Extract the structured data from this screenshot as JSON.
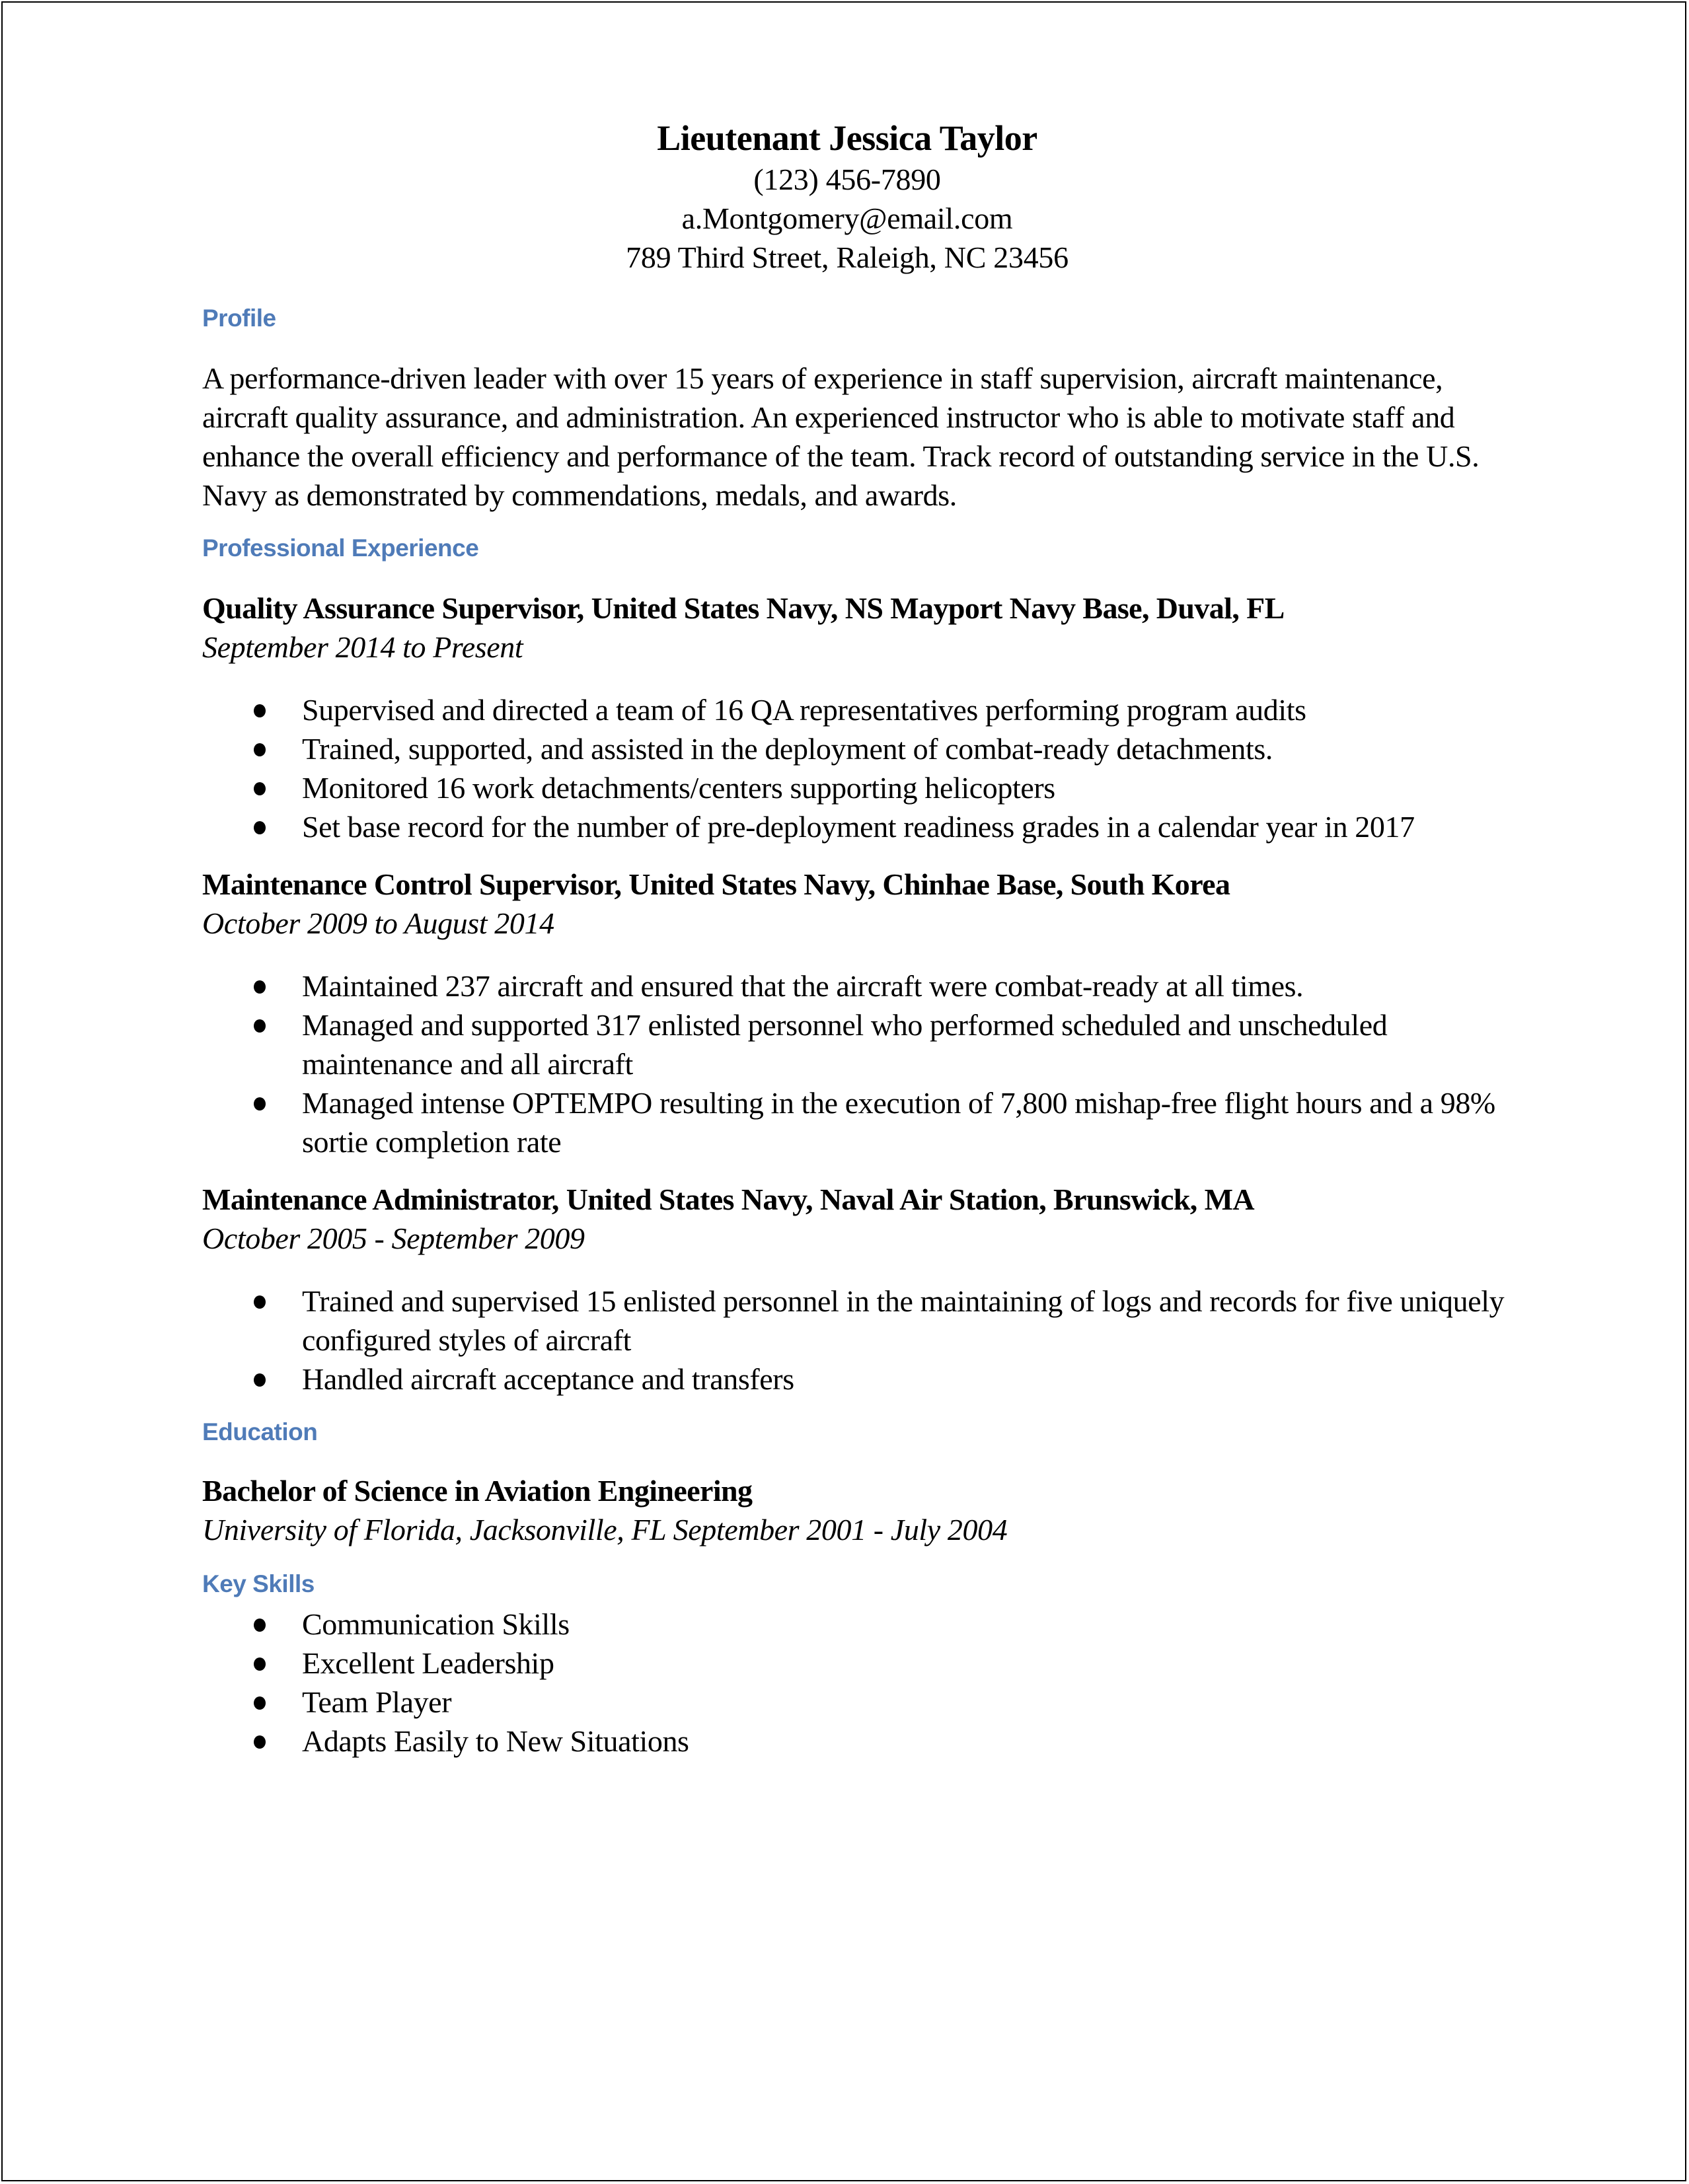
{
  "header": {
    "name": "Lieutenant Jessica Taylor",
    "phone": "(123) 456-7890",
    "email": "a.Montgomery@email.com",
    "address": "789 Third Street, Raleigh, NC 23456"
  },
  "colors": {
    "section_heading": "#4f7bb8",
    "text": "#000000"
  },
  "profile": {
    "heading": "Profile",
    "text": "A performance-driven leader with over 15 years of experience in staff supervision, aircraft maintenance, aircraft quality assurance, and administration. An experienced instructor who is able to motivate staff and enhance the overall efficiency and performance of the team. Track record of outstanding service in the U.S. Navy as demonstrated by commendations, medals, and awards."
  },
  "experience": {
    "heading": "Professional Experience",
    "jobs": [
      {
        "title": "Quality Assurance Supervisor, United States Navy, NS Mayport Navy Base, Duval, FL",
        "dates": "September 2014 to Present",
        "bullets": [
          "Supervised and directed a team of 16 QA representatives performing program audits",
          "Trained, supported, and assisted in the deployment of combat-ready detachments.",
          "Monitored 16 work detachments/centers supporting helicopters",
          "Set base record for the number of pre-deployment readiness grades in a calendar year in  2017"
        ]
      },
      {
        "title": "Maintenance Control Supervisor, United States Navy, Chinhae Base, South Korea",
        "dates": "October 2009 to August 2014",
        "bullets": [
          "Maintained 237 aircraft and ensured that the aircraft were combat-ready at all times.",
          "Managed and supported 317 enlisted personnel who performed scheduled and unscheduled maintenance and all aircraft",
          "Managed intense OPTEMPO resulting in the execution of 7,800 mishap-free flight hours and a 98% sortie completion rate"
        ]
      },
      {
        "title": "Maintenance Administrator, United States Navy, Naval Air Station, Brunswick, MA",
        "dates": "October 2005 - September 2009",
        "bullets": [
          "Trained and supervised 15 enlisted personnel in the maintaining of logs and records for five uniquely configured styles of aircraft",
          "Handled aircraft acceptance and transfers"
        ]
      }
    ]
  },
  "education": {
    "heading": "Education",
    "degree": "Bachelor of Science in Aviation Engineering",
    "detail": "University of Florida, Jacksonville, FL September 2001 - July 2004"
  },
  "skills": {
    "heading": "Key Skills",
    "items": [
      "Communication Skills",
      "Excellent Leadership",
      "Team Player",
      "Adapts Easily to New Situations"
    ]
  }
}
